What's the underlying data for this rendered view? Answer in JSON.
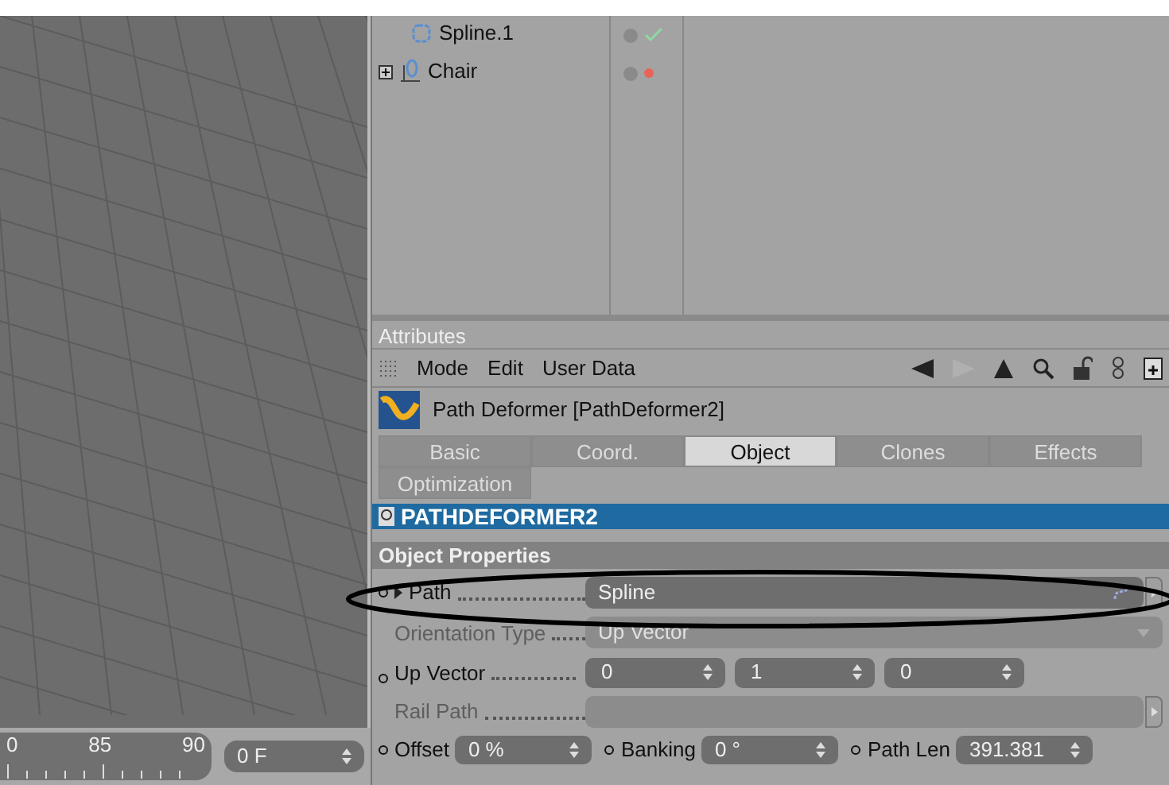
{
  "objects": [
    {
      "name": "Spline.1",
      "kind": "child",
      "enabled": true
    },
    {
      "name": "Chair",
      "kind": "group",
      "enabled": false
    }
  ],
  "timeline": {
    "ticks": [
      "0",
      "85",
      "90"
    ],
    "frame": "0 F"
  },
  "attributes": {
    "title": "Attributes",
    "menu": [
      "Mode",
      "Edit",
      "User Data"
    ],
    "object_title": "Path Deformer [PathDeformer2]",
    "tabs": [
      {
        "label": "Basic",
        "selected": false
      },
      {
        "label": "Coord.",
        "selected": false
      },
      {
        "label": "Object",
        "selected": true
      },
      {
        "label": "Clones",
        "selected": false
      },
      {
        "label": "Effects",
        "selected": false
      },
      {
        "label": "Optimization",
        "selected": false
      }
    ],
    "banner": "PATHDEFORMER2",
    "section": "Object Properties",
    "rows": [
      {
        "kind": "link",
        "label": "Path",
        "value": "Spline",
        "disabled": false
      },
      {
        "kind": "dropdown",
        "label": "Orientation Type",
        "value": "Up Vector",
        "disabled": true
      },
      {
        "kind": "vector",
        "label": "Up Vector",
        "values": [
          "0",
          "1",
          "0"
        ],
        "disabled": false
      },
      {
        "kind": "link",
        "label": "Rail Path",
        "disabled": true
      },
      {
        "kind": "inline",
        "fields": [
          {
            "label": "Offset",
            "value": "0 %"
          },
          {
            "label": "Banking",
            "value": "0 °"
          },
          {
            "label": "Path Len",
            "value": "391.381"
          }
        ]
      }
    ]
  }
}
